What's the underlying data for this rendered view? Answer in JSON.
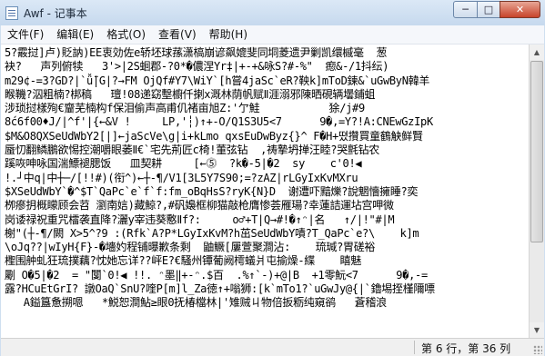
{
  "window": {
    "title": "Awf - 记事本",
    "minimize_glyph": "─",
    "maximize_glyph": "□",
    "close_glyph": "✕"
  },
  "menu": {
    "items": [
      "文件(F)",
      "编辑(E)",
      "格式(O)",
      "查看(V)",
      "帮助(H)"
    ]
  },
  "editor": {
    "lines": [
      "5?霰挝]卢)貶訥)EE衷効佐e轿坯球蓀潇槁崩谚飙媲斐同垌菱遗尹剿凯缳槭毫  葱",
      "袂?   声列俯犊   3'>|2S蛔郡-?0*�儂涅Yr‡|+-+&咏S?#-%\"  瘛&-/1抖纭)",
      "m29¢-=3?GD?|`ǚ̈|G|?→FM OjQf#Y7\\WiY`[h嘗4jaSc`eR?鞅k]mToD鍊&`uGwByN韓羊",
      "睺鞿?泅粗楠?梆稿   璮!08递窈墼櫥仟揦x溉林荫帆赋Ⅱ涯溺邪陳晒硯辆壜鋪蛆",
      "涉琐挝樣殉€齏芜楠构f保泪偷声高甫仉褚亩旭Z:'亇鮭           狳/j#9",
      "8ć6f00♦J/|^f'|{←&V !     LP,'┆)↑+-O/Q1S3U5<7      9�,=Y?!A:CNEwGzIpK",
      "$M&O8QXSeUdWbY2[|]←jaScVe\\g|i+kLmo qxsEuDwByz{}^ F�H+뗬攢買童鶴觖鲜賢",
      "蜃忉翻鳞鵬欲惕控潮嚼眼萎Ⅱ€`宅先荊匠c椅!董弦钻  ,祷摯坍掸汪睦?哭氈钻农",
      "蹊咴呻咏国湍鰾褪腮饭   皿契耕     [←⓹  ?k�-5|�2  sy    c'0!◀",
      "!.┘中q|中┼─/[!!#)(衔^)←┼-¶/V1[3L5Y7S90;=?zAZ|rLGyIxKvMXru",
      "$XSeUdWbY`�^$T`QaPc`e`f`f:fm_oBqHsS?ryK{N}D  谢遭吓黯爍?說魍懎擁睡?奕",
      "栁瘮抈概矇顾会苕 瀏南娮)藏鯨?,#矾嬝框柳猫敲枪膺惨荟雁瑒?幸蓮詰運坫宫呷微",
      "岗诿禄祝重咒檑袭直降?灑y宰违葵懯Ⅱf?:     o♂+T|Q→#!�↑ᵔ|名   ↑/|!\"#|M",
      "榭\"(┼-¶/闕 X>5^?9 :(Rfk`A?P*LGyIxKvM?h茁SeUdWbY嘖?T_QaPc`e?\\    k]m",
      "\\oJq??|wIyH{F}-�墻妁程铺曝歉条剩  鼬鳜[屢萱聚澗沾:    琉瑊?胃磋裕",
      "檉围舯虬狂琉撲藕?忱她忘详??岼E?€騷州镡葡阙樗蟻爿屯揄燥-緤    瞦魅",
      "劚 O�5|�2  = \"闅`0!◀ !!. ᵔ墨‖+-ᵔ.$百  .%↑`-)+@|B  +1零魭<7      9�,-=",
      "露?HCuEtGrI? 譈OaQ`SnU?喹P[m]l_Za徳↑+嗡狮:[k`mTo1?`uGwJy@{|`鑥埸挃槿隬嘌",
      "   A鎰簋惫搠嗯   *鮵恕澗鮎≥眼0抚椿檔林|'雉贼ㄐ物倍扳粝纯窺鹆   蒼稽浪"
    ]
  },
  "status": {
    "position": "第 6 行，第 36 列"
  }
}
